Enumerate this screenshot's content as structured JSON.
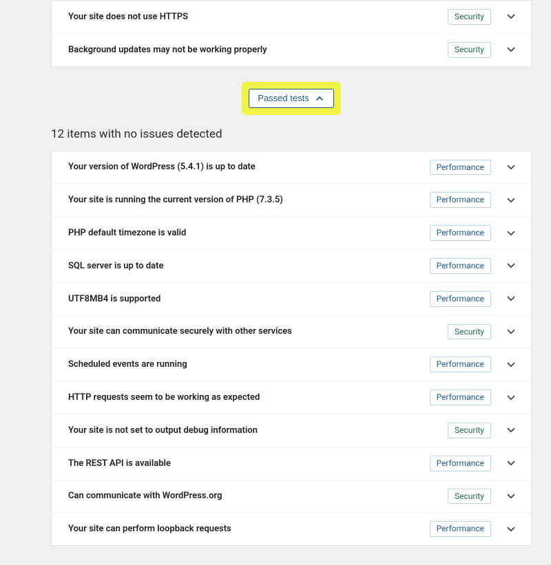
{
  "issues_top": [
    {
      "title": "Your site does not use HTTPS",
      "badge": "Security",
      "badge_type": "security"
    },
    {
      "title": "Background updates may not be working properly",
      "badge": "Security",
      "badge_type": "security"
    }
  ],
  "toggle": {
    "label": "Passed tests"
  },
  "passed_section": {
    "heading": "12 items with no issues detected",
    "items": [
      {
        "title": "Your version of WordPress (5.4.1) is up to date",
        "badge": "Performance",
        "badge_type": "performance"
      },
      {
        "title": "Your site is running the current version of PHP (7.3.5)",
        "badge": "Performance",
        "badge_type": "performance"
      },
      {
        "title": "PHP default timezone is valid",
        "badge": "Performance",
        "badge_type": "performance"
      },
      {
        "title": "SQL server is up to date",
        "badge": "Performance",
        "badge_type": "performance"
      },
      {
        "title": "UTF8MB4 is supported",
        "badge": "Performance",
        "badge_type": "performance"
      },
      {
        "title": "Your site can communicate securely with other services",
        "badge": "Security",
        "badge_type": "security"
      },
      {
        "title": "Scheduled events are running",
        "badge": "Performance",
        "badge_type": "performance"
      },
      {
        "title": "HTTP requests seem to be working as expected",
        "badge": "Performance",
        "badge_type": "performance"
      },
      {
        "title": "Your site is not set to output debug information",
        "badge": "Security",
        "badge_type": "security"
      },
      {
        "title": "The REST API is available",
        "badge": "Performance",
        "badge_type": "performance"
      },
      {
        "title": "Can communicate with WordPress.org",
        "badge": "Security",
        "badge_type": "security"
      },
      {
        "title": "Your site can perform loopback requests",
        "badge": "Performance",
        "badge_type": "performance"
      }
    ]
  }
}
